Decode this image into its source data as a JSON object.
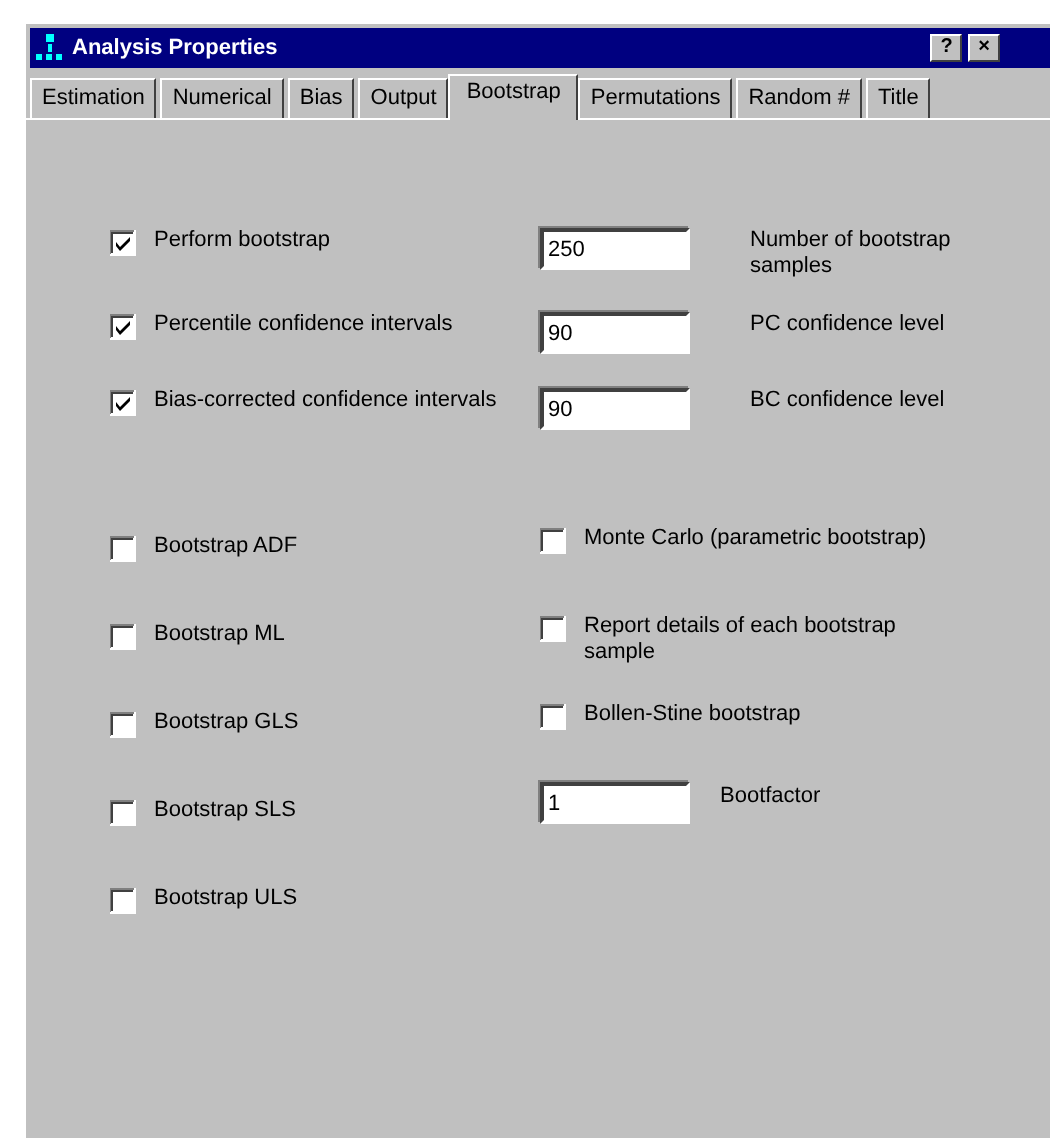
{
  "window": {
    "title": "Analysis Properties"
  },
  "title_buttons": [
    "?",
    "×"
  ],
  "tabs": [
    {
      "label": "Estimation",
      "selected": false
    },
    {
      "label": "Numerical",
      "selected": false
    },
    {
      "label": "Bias",
      "selected": false
    },
    {
      "label": "Output",
      "selected": false
    },
    {
      "label": "Bootstrap",
      "selected": true
    },
    {
      "label": "Permutations",
      "selected": false
    },
    {
      "label": "Random #",
      "selected": false
    },
    {
      "label": "Title",
      "selected": false
    }
  ],
  "bootstrap_options": [
    {
      "label": "Perform bootstrap",
      "checked": true,
      "value": "250",
      "field_label": "Number of bootstrap samples"
    },
    {
      "label": "Percentile confidence intervals",
      "checked": true,
      "value": "90",
      "field_label": "PC confidence level"
    },
    {
      "label": "Bias-corrected confidence intervals",
      "checked": true,
      "value": "90",
      "field_label": "BC confidence level"
    }
  ],
  "estimators": [
    {
      "label": "Bootstrap ADF",
      "checked": false
    },
    {
      "label": "Bootstrap ML",
      "checked": false
    },
    {
      "label": "Bootstrap GLS",
      "checked": false
    },
    {
      "label": "Bootstrap SLS",
      "checked": false
    },
    {
      "label": "Bootstrap ULS",
      "checked": false
    }
  ],
  "options": [
    {
      "kind": "checkbox",
      "label": "Monte Carlo (parametric bootstrap)",
      "checked": false
    },
    {
      "kind": "checkbox",
      "label": "Report details of each bootstrap sample",
      "checked": false
    },
    {
      "kind": "checkbox",
      "label": "Bollen-Stine bootstrap",
      "checked": false
    },
    {
      "kind": "field",
      "value": "1",
      "label": "Bootfactor"
    }
  ]
}
